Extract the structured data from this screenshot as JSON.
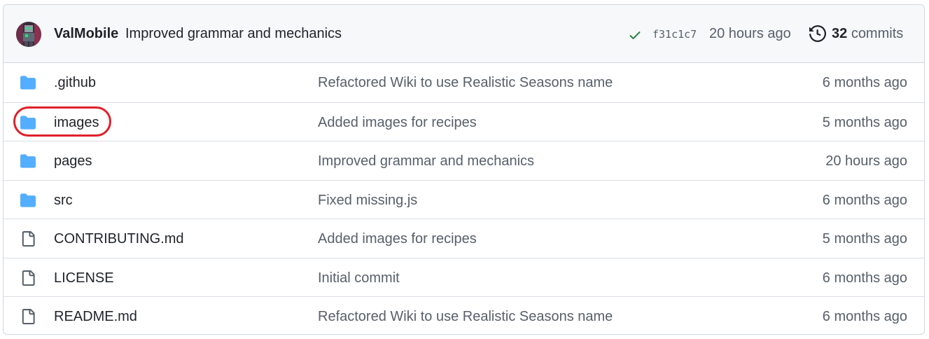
{
  "latest_commit": {
    "avatar_icon": "user-avatar",
    "author": "ValMobile",
    "message": "Improved grammar and mechanics",
    "status_icon": "check-icon",
    "status_color": "#1a7f37",
    "sha": "f31c1c7",
    "time": "20 hours ago",
    "history_icon": "history-icon",
    "commits_count": "32",
    "commits_label": "commits"
  },
  "files": [
    {
      "type": "folder",
      "icon": "folder-icon",
      "name": ".github",
      "message": "Refactored Wiki to use Realistic Seasons name",
      "time": "6 months ago"
    },
    {
      "type": "folder",
      "icon": "folder-icon",
      "name": "images",
      "message": "Added images for recipes",
      "time": "5 months ago",
      "highlighted": true
    },
    {
      "type": "folder",
      "icon": "folder-icon",
      "name": "pages",
      "message": "Improved grammar and mechanics",
      "time": "20 hours ago"
    },
    {
      "type": "folder",
      "icon": "folder-icon",
      "name": "src",
      "message": "Fixed missing.js",
      "time": "6 months ago"
    },
    {
      "type": "file",
      "icon": "file-icon",
      "name": "CONTRIBUTING.md",
      "message": "Added images for recipes",
      "time": "5 months ago"
    },
    {
      "type": "file",
      "icon": "file-icon",
      "name": "LICENSE",
      "message": "Initial commit",
      "time": "6 months ago"
    },
    {
      "type": "file",
      "icon": "file-icon",
      "name": "README.md",
      "message": "Refactored Wiki to use Realistic Seasons name",
      "time": "6 months ago"
    }
  ],
  "colors": {
    "folder": "#54aeff",
    "file": "#57606a",
    "highlight": "#e0202a",
    "header_bg": "#f6f8fa",
    "border": "#d0d7de"
  }
}
